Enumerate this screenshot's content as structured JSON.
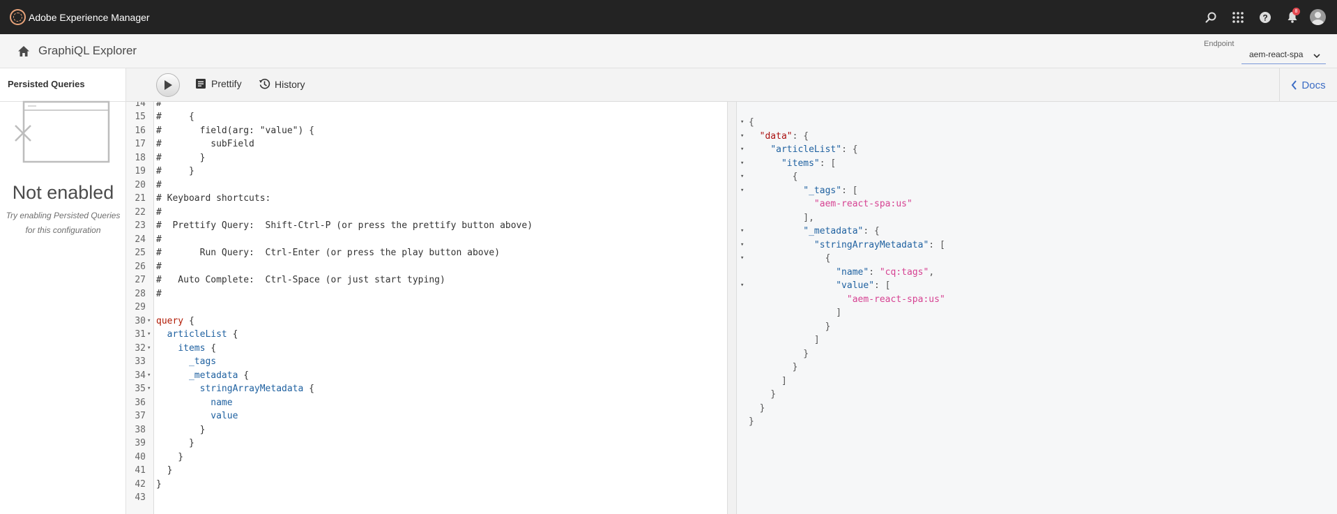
{
  "topbar": {
    "app_title": "Adobe Experience Manager",
    "icons": [
      "search-icon",
      "apps-grid-icon",
      "help-icon",
      "bell-icon",
      "avatar"
    ],
    "notification_count": "8"
  },
  "header": {
    "title": "GraphiQL Explorer",
    "endpoint_label": "Endpoint",
    "endpoint_value": "aem-react-spa"
  },
  "sidebar": {
    "title": "Persisted Queries",
    "empty_title": "Not enabled",
    "empty_desc": "Try enabling Persisted Queries for this configuration"
  },
  "toolbar": {
    "prettify_label": "Prettify",
    "history_label": "History",
    "docs_label": "Docs"
  },
  "editor": {
    "lines": [
      {
        "n": "14",
        "fold": "",
        "t": "#"
      },
      {
        "n": "15",
        "fold": "",
        "t": "#     {"
      },
      {
        "n": "16",
        "fold": "",
        "t": "#       field(arg: \"value\") {"
      },
      {
        "n": "17",
        "fold": "",
        "t": "#         subField"
      },
      {
        "n": "18",
        "fold": "",
        "t": "#       }"
      },
      {
        "n": "19",
        "fold": "",
        "t": "#     }"
      },
      {
        "n": "20",
        "fold": "",
        "t": "#"
      },
      {
        "n": "21",
        "fold": "",
        "t": "# Keyboard shortcuts:"
      },
      {
        "n": "22",
        "fold": "",
        "t": "#"
      },
      {
        "n": "23",
        "fold": "",
        "t": "#  Prettify Query:  Shift-Ctrl-P (or press the prettify button above)"
      },
      {
        "n": "24",
        "fold": "",
        "t": "#"
      },
      {
        "n": "25",
        "fold": "",
        "t": "#       Run Query:  Ctrl-Enter (or press the play button above)"
      },
      {
        "n": "26",
        "fold": "",
        "t": "#"
      },
      {
        "n": "27",
        "fold": "",
        "t": "#   Auto Complete:  Ctrl-Space (or just start typing)"
      },
      {
        "n": "28",
        "fold": "",
        "t": "#"
      },
      {
        "n": "29",
        "fold": "",
        "t": ""
      },
      {
        "n": "30",
        "fold": "▾",
        "t": "query {"
      },
      {
        "n": "31",
        "fold": "▾",
        "t": "  articleList {"
      },
      {
        "n": "32",
        "fold": "▾",
        "t": "    items {"
      },
      {
        "n": "33",
        "fold": "",
        "t": "      _tags"
      },
      {
        "n": "34",
        "fold": "▾",
        "t": "      _metadata {"
      },
      {
        "n": "35",
        "fold": "▾",
        "t": "        stringArrayMetadata {"
      },
      {
        "n": "36",
        "fold": "",
        "t": "          name"
      },
      {
        "n": "37",
        "fold": "",
        "t": "          value"
      },
      {
        "n": "38",
        "fold": "",
        "t": "        }"
      },
      {
        "n": "39",
        "fold": "",
        "t": "      }"
      },
      {
        "n": "40",
        "fold": "",
        "t": "    }"
      },
      {
        "n": "41",
        "fold": "",
        "t": "  }"
      },
      {
        "n": "42",
        "fold": "",
        "t": "}"
      },
      {
        "n": "43",
        "fold": "",
        "t": ""
      }
    ]
  },
  "result": {
    "lines": [
      {
        "fold": "▾",
        "t": "{"
      },
      {
        "fold": "▾",
        "t": "  \"data\": {"
      },
      {
        "fold": "▾",
        "t": "    \"articleList\": {"
      },
      {
        "fold": "▾",
        "t": "      \"items\": ["
      },
      {
        "fold": "▾",
        "t": "        {"
      },
      {
        "fold": "▾",
        "t": "          \"_tags\": ["
      },
      {
        "fold": "",
        "t": "            \"aem-react-spa:us\""
      },
      {
        "fold": "",
        "t": "          ],"
      },
      {
        "fold": "▾",
        "t": "          \"_metadata\": {"
      },
      {
        "fold": "▾",
        "t": "            \"stringArrayMetadata\": ["
      },
      {
        "fold": "▾",
        "t": "              {"
      },
      {
        "fold": "",
        "t": "                \"name\": \"cq:tags\","
      },
      {
        "fold": "▾",
        "t": "                \"value\": ["
      },
      {
        "fold": "",
        "t": "                  \"aem-react-spa:us\""
      },
      {
        "fold": "",
        "t": "                ]"
      },
      {
        "fold": "",
        "t": "              }"
      },
      {
        "fold": "",
        "t": "            ]"
      },
      {
        "fold": "",
        "t": "          }"
      },
      {
        "fold": "",
        "t": "        }"
      },
      {
        "fold": "",
        "t": "      ]"
      },
      {
        "fold": "",
        "t": "    }"
      },
      {
        "fold": "",
        "t": "  }"
      },
      {
        "fold": "",
        "t": "}"
      }
    ]
  }
}
